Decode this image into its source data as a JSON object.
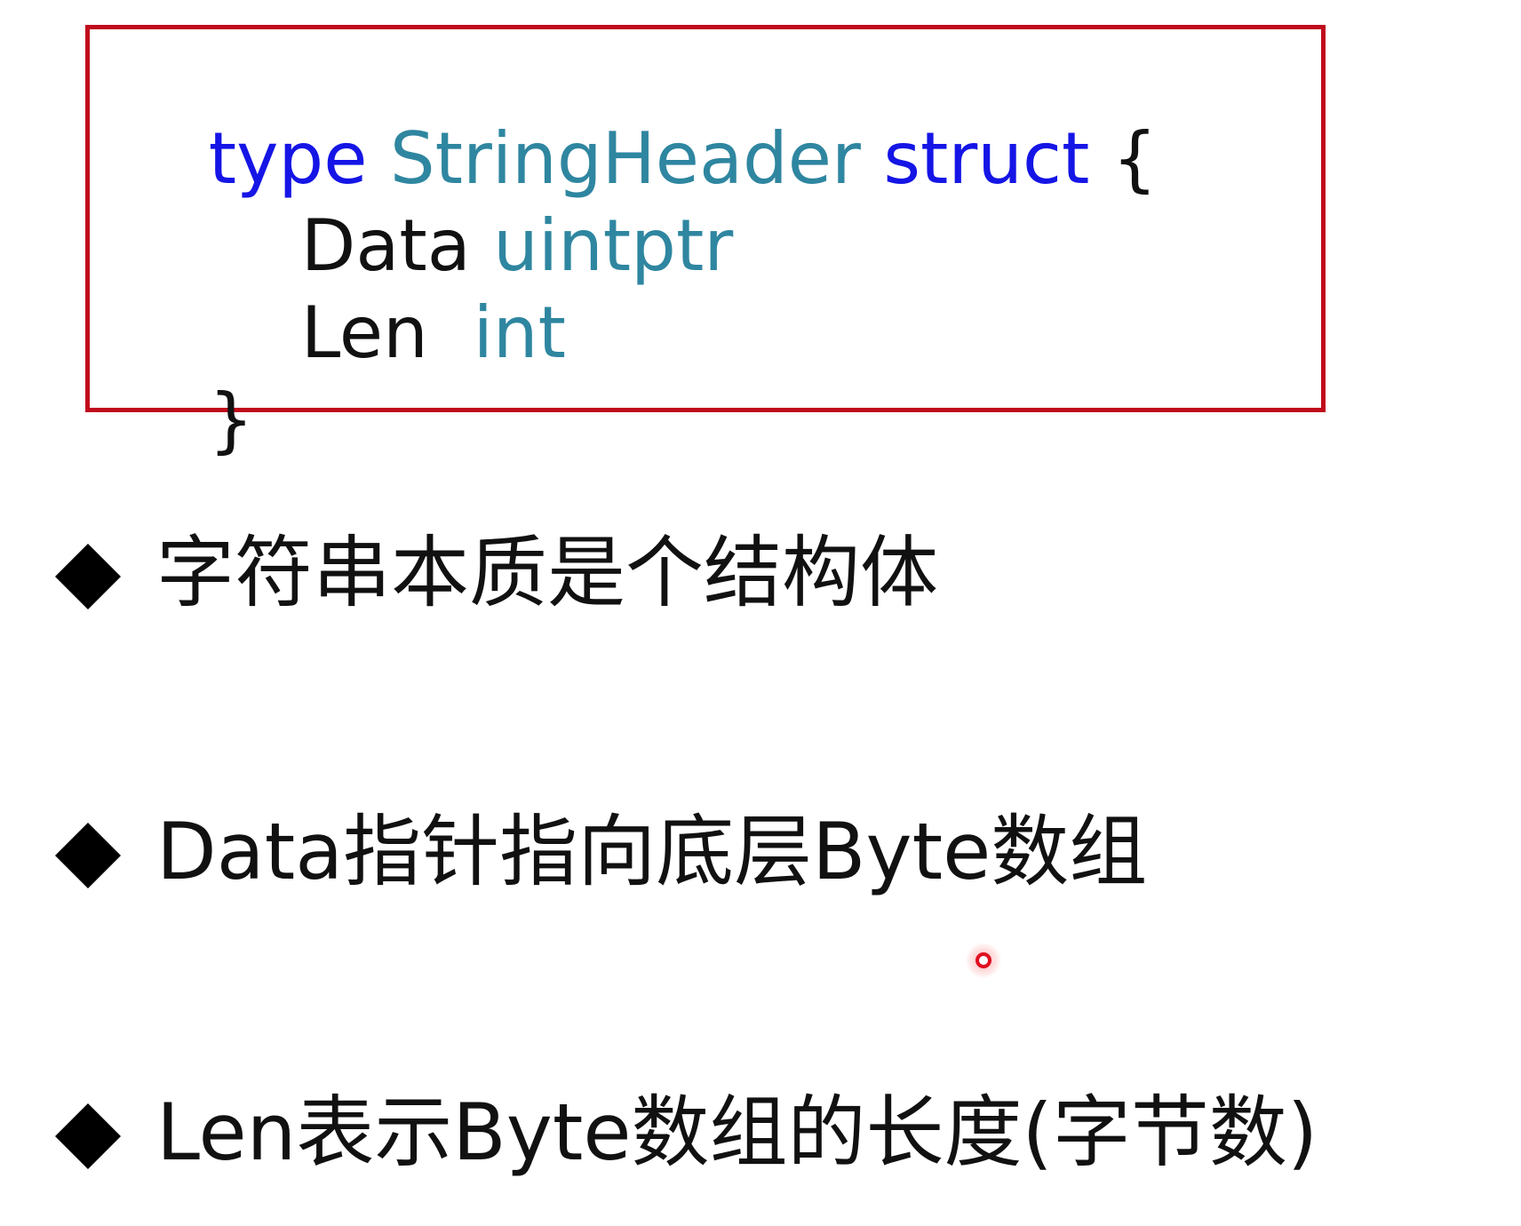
{
  "colors": {
    "border": "#c00a1d",
    "keyword": "#1515e6",
    "type": "#2f86a0",
    "text": "#111111",
    "pointer": "#e01020"
  },
  "code": {
    "line1": {
      "kw_type": "type",
      "name": "StringHeader",
      "kw_struct": "struct",
      "brace": "{"
    },
    "line2": {
      "field": "Data",
      "type": "uintptr"
    },
    "line3": {
      "field": "Len",
      "type": "int"
    },
    "line4": {
      "brace": "}"
    }
  },
  "bullets": [
    {
      "icon": "diamond-bullet-icon",
      "text": "字符串本质是个结构体"
    },
    {
      "icon": "diamond-bullet-icon",
      "text": "Data指针指向底层Byte数组"
    },
    {
      "icon": "diamond-bullet-icon",
      "text": "Len表示Byte数组的长度(字节数)"
    }
  ],
  "pointer": {
    "icon": "laser-pointer-icon"
  }
}
